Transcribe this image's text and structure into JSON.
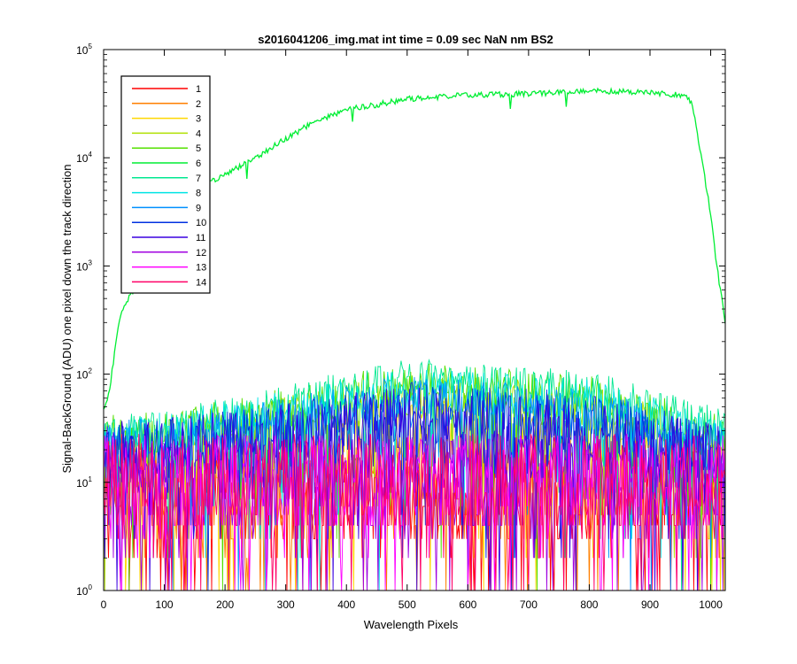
{
  "chart_data": {
    "type": "line",
    "title": "s2016041206_img.mat int time = 0.09 sec  NaN nm BS2",
    "xlabel": "Wavelength Pixels",
    "ylabel": "Signal-BackGround (ADU) one pixel down the track direction",
    "xlim": [
      0,
      1024
    ],
    "ylim": [
      1,
      100000
    ],
    "yscale": "log",
    "grid": false,
    "legend_position": "top-left",
    "x_ticks": [
      0,
      100,
      200,
      300,
      400,
      500,
      600,
      700,
      800,
      900,
      1000
    ],
    "y_ticks": [
      {
        "base": "10",
        "exp": "0",
        "value": 1
      },
      {
        "base": "10",
        "exp": "1",
        "value": 10
      },
      {
        "base": "10",
        "exp": "2",
        "value": 100
      },
      {
        "base": "10",
        "exp": "3",
        "value": 1000
      },
      {
        "base": "10",
        "exp": "4",
        "value": 10000
      },
      {
        "base": "10",
        "exp": "5",
        "value": 100000
      }
    ],
    "series": [
      {
        "name": "1",
        "color": "#ff0000",
        "baseline": [
          [
            0,
            8
          ],
          [
            1024,
            8
          ]
        ],
        "spread": 1.6
      },
      {
        "name": "2",
        "color": "#ff7f00",
        "baseline": [
          [
            0,
            9
          ],
          [
            1024,
            9
          ]
        ],
        "spread": 1.6
      },
      {
        "name": "3",
        "color": "#ffd700",
        "baseline": [
          [
            0,
            12
          ],
          [
            200,
            14
          ],
          [
            500,
            30
          ],
          [
            800,
            25
          ],
          [
            1024,
            10
          ]
        ],
        "spread": 1.4
      },
      {
        "name": "4",
        "color": "#b0e000",
        "baseline": [
          [
            0,
            20
          ],
          [
            200,
            30
          ],
          [
            500,
            65
          ],
          [
            800,
            50
          ],
          [
            1024,
            20
          ]
        ],
        "spread": 1.25
      },
      {
        "name": "5",
        "color": "#55e000",
        "baseline": [
          [
            0,
            25
          ],
          [
            200,
            35
          ],
          [
            500,
            80
          ],
          [
            800,
            60
          ],
          [
            1024,
            25
          ]
        ],
        "spread": 1.25
      },
      {
        "name": "6",
        "color": "#00ee33",
        "smooth": true,
        "baseline": [
          [
            0,
            45
          ],
          [
            10,
            70
          ],
          [
            20,
            200
          ],
          [
            30,
            400
          ],
          [
            50,
            600
          ],
          [
            100,
            2500
          ],
          [
            150,
            5000
          ],
          [
            200,
            7000
          ],
          [
            250,
            10000
          ],
          [
            300,
            15000
          ],
          [
            350,
            22000
          ],
          [
            400,
            28000
          ],
          [
            450,
            31000
          ],
          [
            500,
            35000
          ],
          [
            600,
            38000
          ],
          [
            700,
            39000
          ],
          [
            800,
            42000
          ],
          [
            900,
            40000
          ],
          [
            960,
            38000
          ],
          [
            970,
            30000
          ],
          [
            985,
            10000
          ],
          [
            1000,
            3000
          ],
          [
            1010,
            1000
          ],
          [
            1024,
            300
          ]
        ],
        "spread": 1.04
      },
      {
        "name": "7",
        "color": "#00e890",
        "baseline": [
          [
            0,
            25
          ],
          [
            200,
            40
          ],
          [
            500,
            90
          ],
          [
            800,
            70
          ],
          [
            1024,
            30
          ]
        ],
        "spread": 1.22
      },
      {
        "name": "8",
        "color": "#00e5e5",
        "baseline": [
          [
            0,
            22
          ],
          [
            200,
            35
          ],
          [
            500,
            70
          ],
          [
            800,
            55
          ],
          [
            1024,
            25
          ]
        ],
        "spread": 1.25
      },
      {
        "name": "9",
        "color": "#0090ff",
        "baseline": [
          [
            0,
            20
          ],
          [
            200,
            28
          ],
          [
            500,
            55
          ],
          [
            800,
            42
          ],
          [
            1024,
            20
          ]
        ],
        "spread": 1.3
      },
      {
        "name": "10",
        "color": "#0030e0",
        "baseline": [
          [
            0,
            18
          ],
          [
            200,
            24
          ],
          [
            500,
            45
          ],
          [
            800,
            35
          ],
          [
            1024,
            18
          ]
        ],
        "spread": 1.35
      },
      {
        "name": "11",
        "color": "#3a00e0",
        "baseline": [
          [
            0,
            16
          ],
          [
            200,
            20
          ],
          [
            500,
            35
          ],
          [
            800,
            28
          ],
          [
            1024,
            15
          ]
        ],
        "spread": 1.45
      },
      {
        "name": "12",
        "color": "#a000e0",
        "baseline": [
          [
            0,
            10
          ],
          [
            1024,
            10
          ]
        ],
        "spread": 1.6
      },
      {
        "name": "13",
        "color": "#ff00ff",
        "baseline": [
          [
            0,
            10
          ],
          [
            1024,
            10
          ]
        ],
        "spread": 1.6
      },
      {
        "name": "14",
        "color": "#ff0066",
        "baseline": [
          [
            0,
            10
          ],
          [
            1024,
            10
          ]
        ],
        "spread": 1.6
      }
    ]
  }
}
